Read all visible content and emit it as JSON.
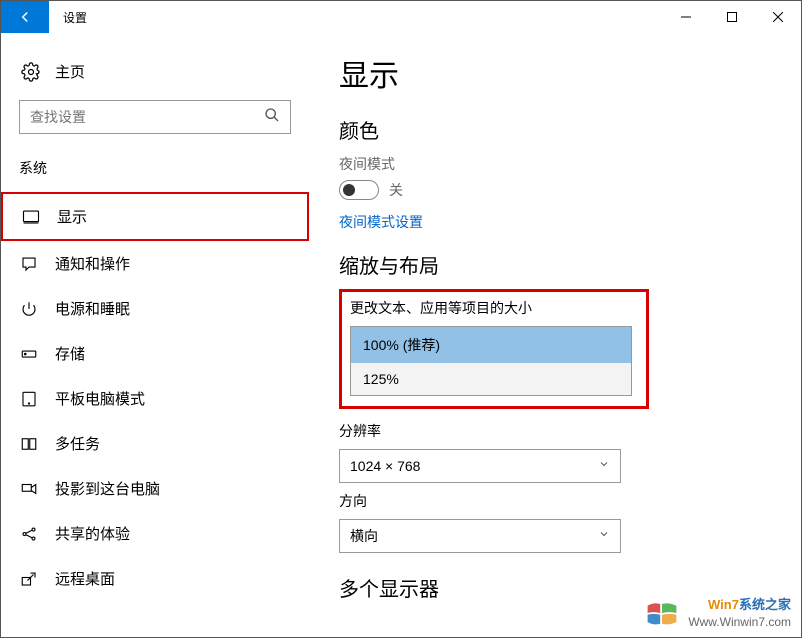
{
  "window": {
    "title": "设置"
  },
  "sidebar": {
    "home": "主页",
    "search_placeholder": "查找设置",
    "category": "系统",
    "items": [
      {
        "label": "显示"
      },
      {
        "label": "通知和操作"
      },
      {
        "label": "电源和睡眠"
      },
      {
        "label": "存储"
      },
      {
        "label": "平板电脑模式"
      },
      {
        "label": "多任务"
      },
      {
        "label": "投影到这台电脑"
      },
      {
        "label": "共享的体验"
      },
      {
        "label": "远程桌面"
      }
    ]
  },
  "main": {
    "title": "显示",
    "color_section": "颜色",
    "night_mode_label": "夜间模式",
    "night_mode_state": "关",
    "night_mode_settings": "夜间模式设置",
    "scale_section": "缩放与布局",
    "scale_label": "更改文本、应用等项目的大小",
    "scale_options": [
      "100% (推荐)",
      "125%"
    ],
    "resolution_label": "分辨率",
    "resolution_value": "1024 × 768",
    "orientation_label": "方向",
    "orientation_value": "横向",
    "multi_display_section": "多个显示器"
  },
  "watermark": {
    "line1_left": "Win7",
    "line1_right": "系统之家",
    "line2": "Www.Winwin7.com"
  }
}
